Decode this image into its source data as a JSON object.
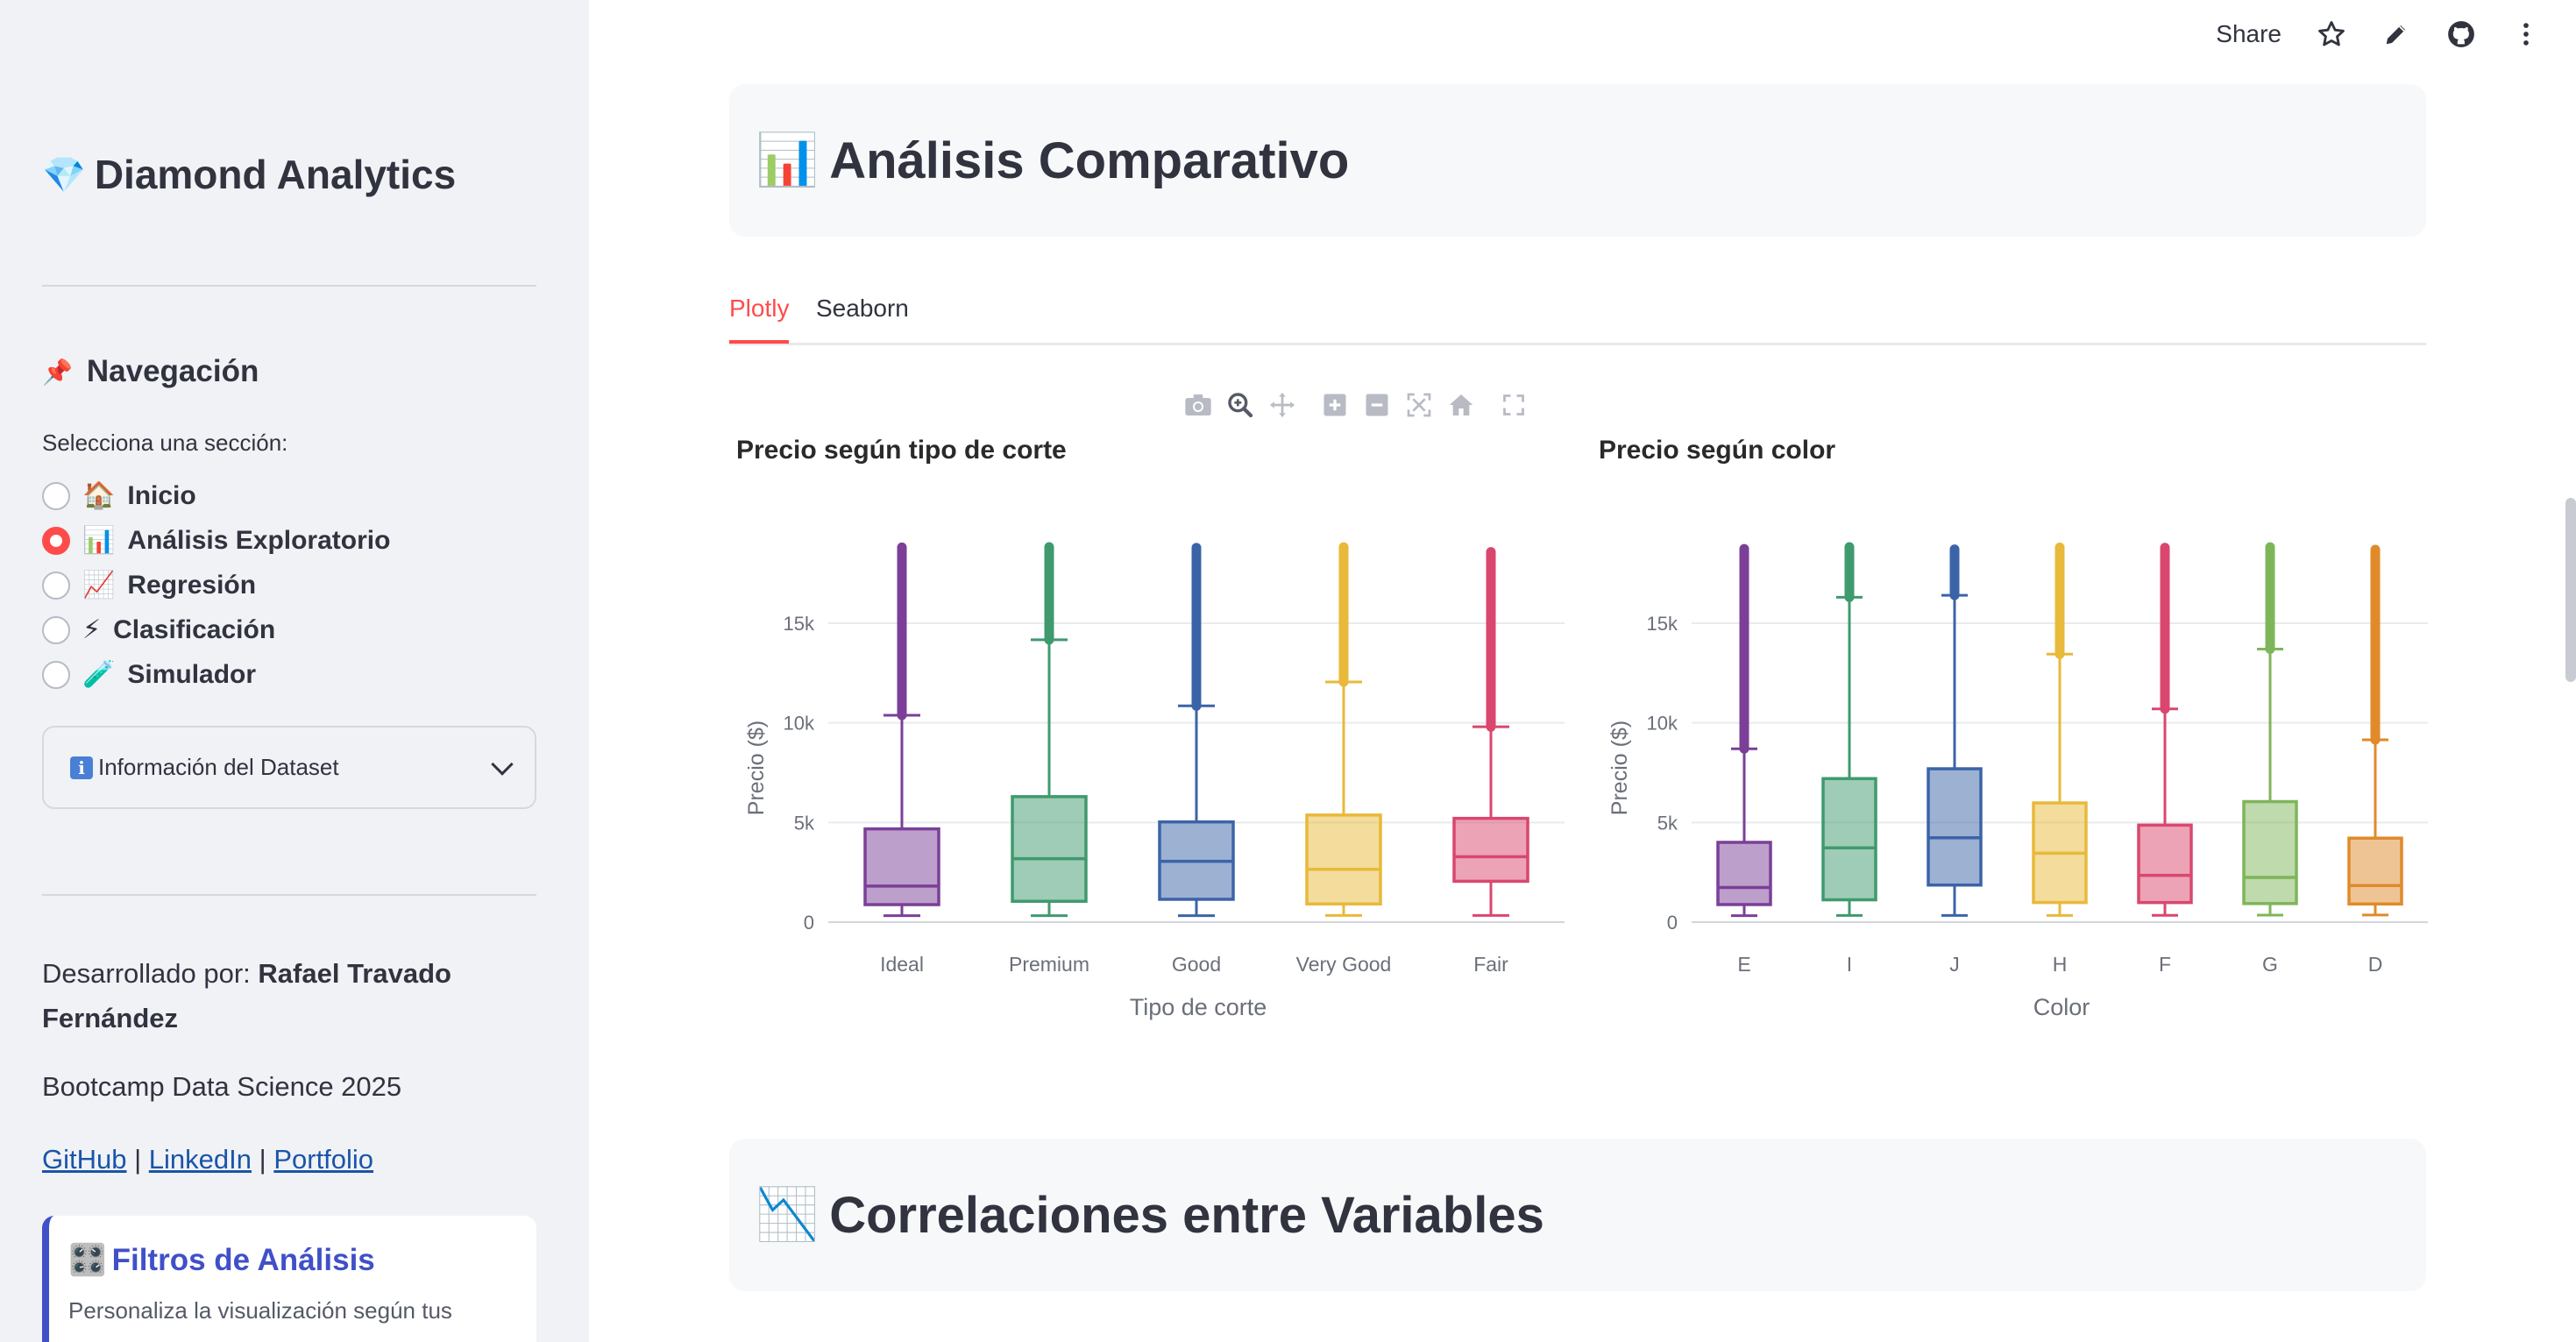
{
  "sidebar": {
    "app_title": "Diamond Analytics",
    "nav_title": "Navegación",
    "radio_label": "Selecciona una sección:",
    "items": [
      {
        "icon": "🏠",
        "label": "Inicio",
        "selected": false
      },
      {
        "icon": "📊",
        "label": "Análisis Exploratorio",
        "selected": true
      },
      {
        "icon": "📈",
        "label": "Regresión",
        "selected": false
      },
      {
        "icon": "⚡",
        "label": "Clasificación",
        "selected": false
      },
      {
        "icon": "🧪",
        "label": "Simulador",
        "selected": false
      }
    ],
    "expander_label": "Información del Dataset",
    "developed_by": "Desarrollado por:",
    "developer": "Rafael Travado Fernández",
    "bootcamp": "Bootcamp Data Science 2025",
    "links": [
      "GitHub",
      "LinkedIn",
      "Portfolio"
    ],
    "link_separator": "|",
    "filter_card": {
      "title": "Filtros de Análisis",
      "description": "Personaliza la visualización según tus"
    }
  },
  "toolbar": {
    "share": "Share"
  },
  "main": {
    "section1_title": "Análisis Comparativo",
    "tabs": [
      "Plotly",
      "Seaborn"
    ],
    "active_tab": "Plotly",
    "section2_title": "Correlaciones entre Variables"
  },
  "chart_data": [
    {
      "type": "box",
      "title": "Precio según tipo de corte",
      "xlabel": "Tipo de corte",
      "ylabel": "Precio ($)",
      "ylim": [
        0,
        19000
      ],
      "yticks": [
        0,
        5000,
        10000,
        15000
      ],
      "ytick_labels": [
        "0",
        "5k",
        "10k",
        "15k"
      ],
      "categories": [
        "Ideal",
        "Premium",
        "Good",
        "Very Good",
        "Fair"
      ],
      "colors": [
        "#7b3f98",
        "#3f9a6e",
        "#3b64a8",
        "#e8b93a",
        "#d9476e"
      ],
      "boxes": [
        {
          "min": 326,
          "q1": 878,
          "median": 1810,
          "q3": 4678,
          "upper_fence": 10380,
          "outliers_from": 10380,
          "max": 18806
        },
        {
          "min": 326,
          "q1": 1046,
          "median": 3185,
          "q3": 6296,
          "upper_fence": 14170,
          "outliers_from": 14170,
          "max": 18823
        },
        {
          "min": 327,
          "q1": 1145,
          "median": 3050,
          "q3": 5028,
          "upper_fence": 10850,
          "outliers_from": 10850,
          "max": 18788
        },
        {
          "min": 336,
          "q1": 912,
          "median": 2648,
          "q3": 5373,
          "upper_fence": 12050,
          "outliers_from": 12050,
          "max": 18818
        },
        {
          "min": 337,
          "q1": 2050,
          "median": 3282,
          "q3": 5206,
          "upper_fence": 9800,
          "outliers_from": 9800,
          "max": 18574
        }
      ]
    },
    {
      "type": "box",
      "title": "Precio según color",
      "xlabel": "Color",
      "ylabel": "Precio ($)",
      "ylim": [
        0,
        19000
      ],
      "yticks": [
        0,
        5000,
        10000,
        15000
      ],
      "ytick_labels": [
        "0",
        "5k",
        "10k",
        "15k"
      ],
      "categories": [
        "E",
        "I",
        "J",
        "H",
        "F",
        "G",
        "D"
      ],
      "colors": [
        "#7b3f98",
        "#3f9a6e",
        "#3b64a8",
        "#e8b93a",
        "#d9476e",
        "#7fb55a",
        "#e08a2a"
      ],
      "boxes": [
        {
          "min": 326,
          "q1": 882,
          "median": 1739,
          "q3": 4003,
          "upper_fence": 8700,
          "outliers_from": 8700,
          "max": 18731
        },
        {
          "min": 334,
          "q1": 1120,
          "median": 3730,
          "q3": 7202,
          "upper_fence": 16300,
          "outliers_from": 16300,
          "max": 18823
        },
        {
          "min": 335,
          "q1": 1860,
          "median": 4234,
          "q3": 7695,
          "upper_fence": 16400,
          "outliers_from": 16400,
          "max": 18710
        },
        {
          "min": 337,
          "q1": 984,
          "median": 3460,
          "q3": 5980,
          "upper_fence": 13450,
          "outliers_from": 13450,
          "max": 18803
        },
        {
          "min": 342,
          "q1": 982,
          "median": 2345,
          "q3": 4868,
          "upper_fence": 10700,
          "outliers_from": 10700,
          "max": 18791
        },
        {
          "min": 354,
          "q1": 931,
          "median": 2242,
          "q3": 6048,
          "upper_fence": 13700,
          "outliers_from": 13700,
          "max": 18818
        },
        {
          "min": 357,
          "q1": 911,
          "median": 1838,
          "q3": 4214,
          "upper_fence": 9150,
          "outliers_from": 9150,
          "max": 18693
        }
      ]
    }
  ]
}
